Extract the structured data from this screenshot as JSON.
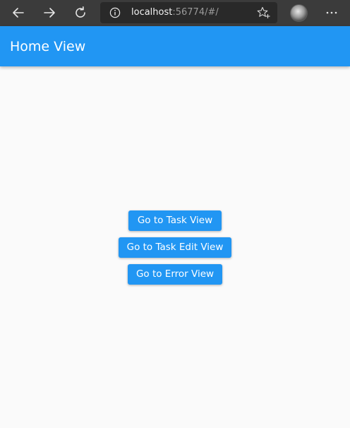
{
  "browser": {
    "url_host": "localhost",
    "url_rest": ":56774/#/",
    "icons": {
      "back": "arrow-left-icon",
      "forward": "arrow-right-icon",
      "reload": "refresh-icon",
      "info": "info-icon",
      "favorite": "star-plus-icon",
      "profile": "avatar",
      "more": "more-horizontal-icon"
    }
  },
  "app_bar": {
    "title": "Home View",
    "color": "#2196f3"
  },
  "main": {
    "buttons": [
      {
        "label": "Go to Task View"
      },
      {
        "label": "Go to Task Edit View"
      },
      {
        "label": "Go to Error View"
      }
    ]
  },
  "colors": {
    "accent": "#2196f3",
    "background": "#fafafa",
    "browser_chrome": "#3b3b3b"
  }
}
